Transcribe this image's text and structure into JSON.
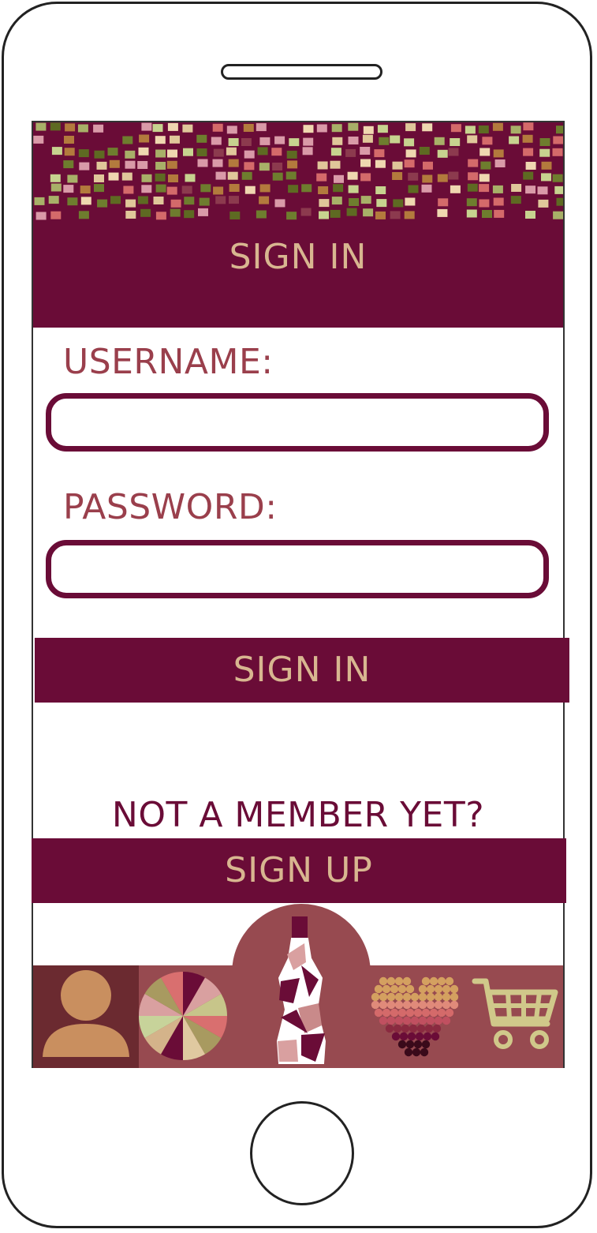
{
  "header": {
    "title": "SIGN IN"
  },
  "form": {
    "username_label": "USERNAME:",
    "username_value": "",
    "password_label": "PASSWORD:",
    "password_value": "",
    "submit_label": "SIGN IN"
  },
  "signup": {
    "prompt": "NOT A MEMBER YET?",
    "button_label": "SIGN UP"
  },
  "nav": {
    "items": [
      {
        "icon": "user-icon"
      },
      {
        "icon": "wine-wheel-icon"
      },
      {
        "icon": "wine-bottle-icon"
      },
      {
        "icon": "heart-icon"
      },
      {
        "icon": "cart-icon"
      }
    ]
  },
  "colors": {
    "primary": "#6a0c37",
    "accent_text": "#d8b690",
    "label_text": "#9a3f4c",
    "nav_bg": "#974a50",
    "nav_user_bg": "#6b2a30"
  }
}
